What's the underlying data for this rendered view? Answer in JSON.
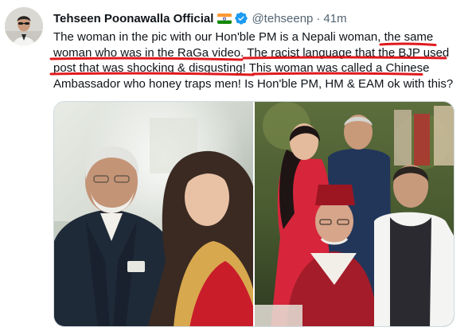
{
  "tweet": {
    "display_name": "Tehseen Poonawalla Official",
    "handle": "@tehseenp",
    "separator": "·",
    "time": "41m",
    "text_parts": [
      "The woman in the pic with our Hon'ble PM is a Nepali woman, ",
      "the same woman who was in the RaGa video.",
      " ",
      "The racist language that the BJP used post that was shocking & disgusting!",
      " ",
      "This woman was called a Chinese",
      " Ambassador who honey traps men! Is Hon'ble PM, HM & EAM ok with this?"
    ]
  },
  "icons": {
    "flag": "india-flag-icon",
    "verified": "verified-badge-icon"
  },
  "colors": {
    "verified_blue": "#1d9bf0",
    "underline_red": "#e0191e",
    "secondary_text": "#536471"
  },
  "media": {
    "images": [
      "photo-left",
      "photo-right"
    ]
  }
}
